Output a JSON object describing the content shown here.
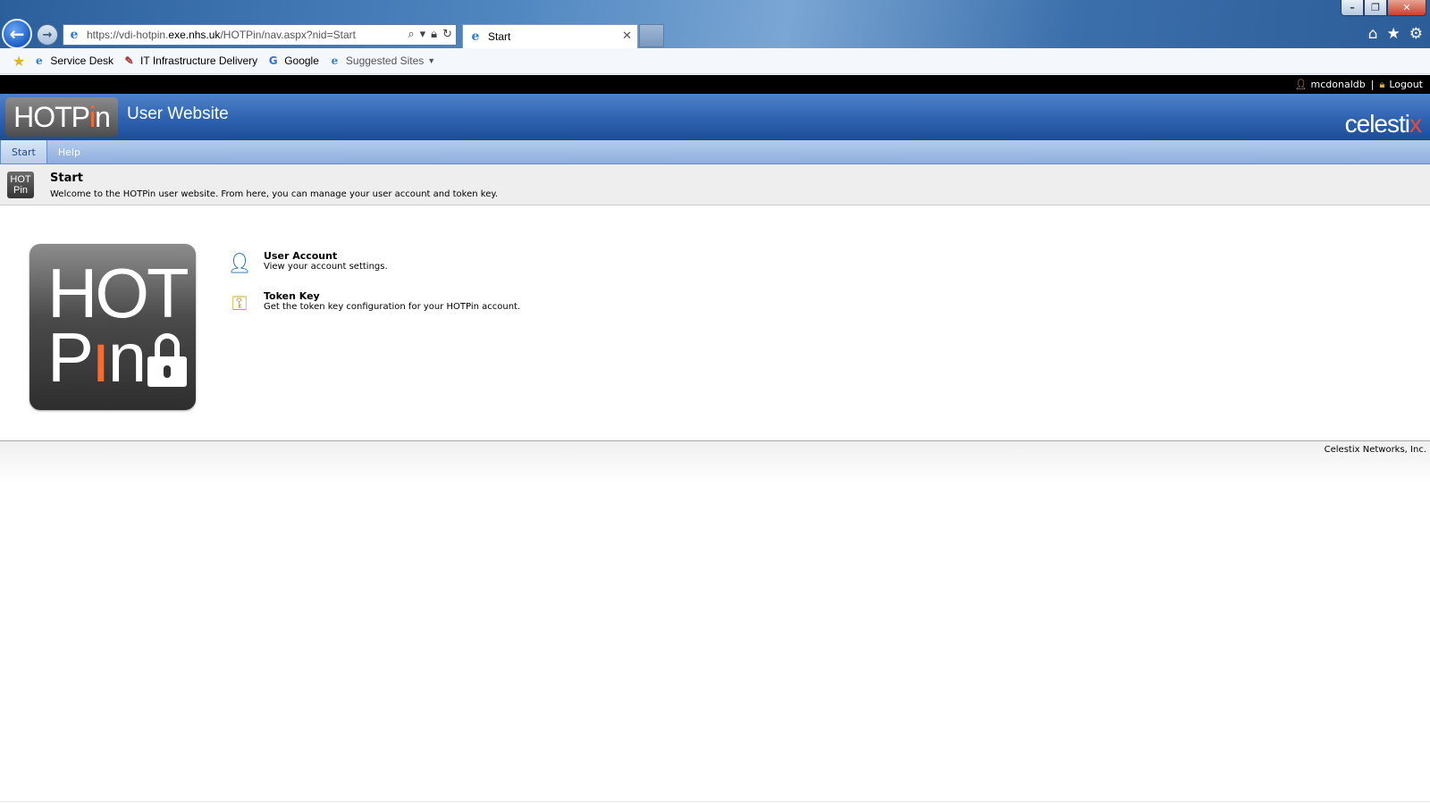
{
  "browser": {
    "window_controls": {
      "minimize": "–",
      "restore": "❐",
      "close": "✕"
    },
    "address": {
      "prefix": "https://vdi-hotpin.",
      "host": "exe.nhs.uk",
      "path": "/HOTPin/nav.aspx?nid=Start"
    },
    "tab": {
      "title": "Start",
      "close": "✕"
    },
    "favorites": [
      {
        "label": "Service Desk",
        "icon": "ie-page-icon"
      },
      {
        "label": "IT Infrastructure Delivery",
        "icon": "pencil-page-icon"
      },
      {
        "label": "Google",
        "icon": "google-icon"
      },
      {
        "label": "Suggested Sites",
        "icon": "ie-page-icon"
      }
    ],
    "right_icons": [
      "home-icon",
      "star-icon",
      "gear-icon"
    ]
  },
  "userbar": {
    "username": "mcdonaldb",
    "separator": "|",
    "logout": "Logout"
  },
  "header": {
    "logo_hot": "HOTP",
    "logo_i": "i",
    "logo_n": "n",
    "title": "User Website",
    "brand": "celesti",
    "brand_x": "x"
  },
  "nav": {
    "tabs": [
      {
        "label": "Start",
        "active": true
      },
      {
        "label": "Help",
        "active": false
      }
    ]
  },
  "page": {
    "mini_logo_top": "HOT",
    "mini_logo_bottom": "Pin",
    "title": "Start",
    "description": "Welcome to the HOTPin user website. From here, you can manage your user account and token key."
  },
  "big_logo": {
    "line1": "HOT",
    "line2_p": "P",
    "line2_i": "ı",
    "line2_n": "n"
  },
  "links": [
    {
      "title": "User Account",
      "description": "View your account settings.",
      "icon": "user-icon"
    },
    {
      "title": "Token Key",
      "description": "Get the token key configuration for your HOTPin account.",
      "icon": "key-icon"
    }
  ],
  "footer": {
    "copyright": "Celestix Networks, Inc."
  },
  "colors": {
    "header_blue": "#2e62b0",
    "nav_blue": "#8eaee0",
    "accent_orange": "#ff6a2b",
    "celestix_red": "#e84a3c"
  }
}
